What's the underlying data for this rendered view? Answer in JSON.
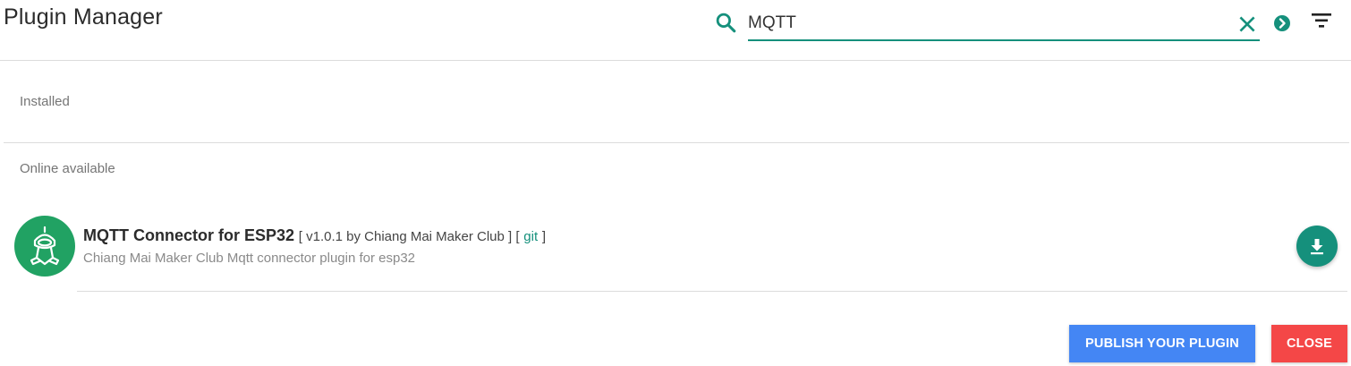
{
  "header": {
    "title": "Plugin Manager",
    "search_value": "MQTT",
    "icons": [
      "search-icon",
      "clear-icon",
      "go-arrow-icon",
      "filter-icon"
    ]
  },
  "sections": {
    "installed_label": "Installed",
    "online_label": "Online available"
  },
  "plugins": [
    {
      "name": "MQTT Connector for ESP32",
      "meta": "[ v1.0.1 by Chiang Mai Maker Club ] [",
      "git_label": "git",
      "meta_close": "]",
      "description": "Chiang Mai Maker Club Mqtt connector plugin for esp32",
      "action_icon": "download-icon"
    }
  ],
  "footer": {
    "publish_label": "PUBLISH YOUR PLUGIN",
    "close_label": "CLOSE"
  },
  "colors": {
    "accent": "#15907c",
    "logo": "#21a263",
    "publish": "#4486f4",
    "close": "#f44747"
  }
}
